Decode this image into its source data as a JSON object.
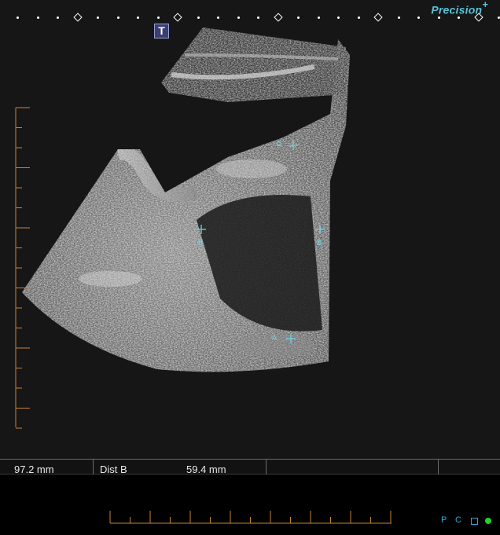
{
  "logo": {
    "text": "Precision",
    "suffix": "+"
  },
  "toolbar": {
    "text_tool_label": "T"
  },
  "calipers": [
    {
      "label": "B"
    },
    {
      "label": "B"
    },
    {
      "label": "A"
    }
  ],
  "measurements": {
    "value_a": "97.2 mm",
    "dist_label": "Dist  B",
    "value_b": "59.4 mm"
  },
  "status": {
    "p_label": "P",
    "c_label": "C"
  },
  "colors": {
    "accent": "#58c2d6",
    "caliper": "#6fd4e4",
    "scale": "#c8843a",
    "status_green": "#22d22a"
  },
  "icons": {
    "text_tool": "text-annotation-icon",
    "caliper_cross": "caliper-cross-icon",
    "depth_scale": "depth-ruler-icon",
    "status_indicator": "green-dot-icon"
  }
}
